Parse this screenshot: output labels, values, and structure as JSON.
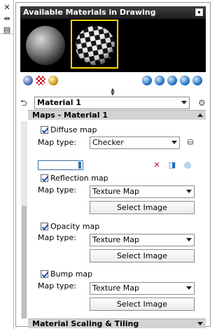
{
  "palette": {
    "header_bg": "#2a2a2a",
    "section_bg": "#d3d3d3",
    "selection_border": "#ffd700",
    "accent_blue": "#3a6ea5"
  },
  "left_strip": {
    "icons": [
      "close-icon",
      "auto-hide-icon",
      "properties-icon"
    ]
  },
  "materials_panel": {
    "title": "Available Materials in Drawing",
    "swatches": [
      {
        "name": "sphere-gray",
        "selected": false
      },
      {
        "name": "sphere-checker",
        "selected": true
      }
    ],
    "left_icons": [
      "sphere-icon",
      "checker-icon",
      "light-sphere-icon"
    ],
    "right_icons": [
      "globe-icon",
      "delete-material-icon",
      "apply-material-icon",
      "material-settings-icon",
      "export-icon"
    ]
  },
  "material_selector": {
    "value": "Material 1"
  },
  "maps_section": {
    "title": "Maps - Material 1",
    "diffuse": {
      "checkbox_label": "Diffuse map",
      "checked": true,
      "map_type_label": "Map type:",
      "map_type_value": "Checker"
    },
    "reflection": {
      "checkbox_label": "Reflection map",
      "checked": true,
      "map_type_label": "Map type:",
      "map_type_value": "Texture Map",
      "button_label": "Select Image"
    },
    "opacity": {
      "checkbox_label": "Opacity map",
      "checked": true,
      "map_type_label": "Map type:",
      "map_type_value": "Texture Map",
      "button_label": "Select Image"
    },
    "bump": {
      "checkbox_label": "Bump map",
      "checked": true,
      "map_type_label": "Map type:",
      "map_type_value": "Texture Map",
      "button_label": "Select Image"
    }
  },
  "scaling_section": {
    "title": "Material Scaling & Tiling"
  }
}
